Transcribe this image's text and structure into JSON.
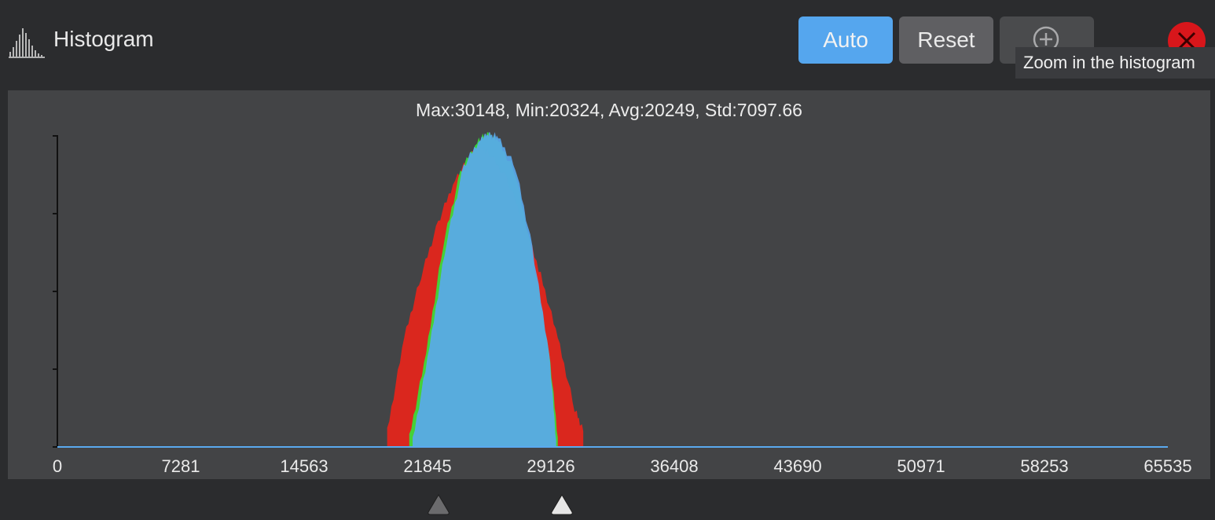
{
  "header": {
    "title": "Histogram",
    "icon": "histogram-icon",
    "auto_label": "Auto",
    "reset_label": "Reset",
    "zoom_icon": "zoom-in-icon",
    "close_icon": "close-icon",
    "tooltip": "Zoom in the histogram"
  },
  "colors": {
    "accent": "#55a6ee",
    "red_channel": "#e3261c",
    "green_channel": "#36e33a",
    "blue_channel": "#5aa9ef",
    "close": "#d8161b"
  },
  "stats_text": "Max:30148, Min:20324, Avg:20249, Std:7097.66",
  "chart_data": {
    "type": "area",
    "title": "Max:30148, Min:20324, Avg:20249, Std:7097.66",
    "xlim": [
      0,
      65535
    ],
    "x_ticks": [
      "0",
      "7281",
      "14563",
      "21845",
      "29126",
      "36408",
      "43690",
      "50971",
      "58253",
      "65535"
    ],
    "y_tick_count": 5,
    "y_tick_labels": false,
    "grid": false,
    "series": [
      {
        "color": "red",
        "x": [
          19500,
          20500,
          21500,
          22500,
          23500,
          24500,
          25000,
          25500,
          26500,
          27500,
          28500,
          29500,
          30500,
          31000
        ],
        "values": [
          0.05,
          0.35,
          0.55,
          0.72,
          0.86,
          0.94,
          0.95,
          0.94,
          0.86,
          0.72,
          0.55,
          0.35,
          0.12,
          0.05
        ]
      },
      {
        "color": "green",
        "x": [
          20800,
          21800,
          22800,
          23800,
          24800,
          25400,
          26000,
          27000,
          28000,
          29000,
          29500
        ],
        "values": [
          0.03,
          0.3,
          0.65,
          0.88,
          0.98,
          1.0,
          0.98,
          0.88,
          0.62,
          0.3,
          0.03
        ]
      },
      {
        "color": "blue",
        "x": [
          21000,
          22000,
          23000,
          24000,
          25000,
          25500,
          26000,
          27000,
          28000,
          29000,
          29400
        ],
        "values": [
          0.02,
          0.32,
          0.66,
          0.9,
          0.99,
          1.0,
          0.99,
          0.9,
          0.64,
          0.3,
          0.02
        ]
      }
    ],
    "range_markers": {
      "low": 21845,
      "high": 29126
    }
  }
}
